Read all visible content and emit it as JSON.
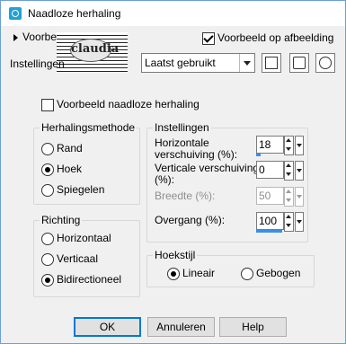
{
  "window": {
    "title": "Naadloze herhaling"
  },
  "preview": {
    "toggle_label": "Voorbeeld",
    "stamp_text": "claudia"
  },
  "header": {
    "preview_on_image_label": "Voorbeeld op afbeelding",
    "preview_on_image_checked": true,
    "settings_label": "Instellingen",
    "preset_value": "Laatst gebruikt"
  },
  "seamless_preview": {
    "label": "Voorbeeld naadloze herhaling",
    "checked": false
  },
  "repeat_method": {
    "title": "Herhalingsmethode",
    "options": [
      "Rand",
      "Hoek",
      "Spiegelen"
    ],
    "selected": "Hoek"
  },
  "direction": {
    "title": "Richting",
    "options": [
      "Horizontaal",
      "Verticaal",
      "Bidirectioneel"
    ],
    "selected": "Bidirectioneel"
  },
  "settings": {
    "title": "Instellingen",
    "horizontal_offset": {
      "label_line1": "Horizontale",
      "label_line2": "verschuiving (%):",
      "value": "18",
      "fill": 0.18
    },
    "vertical_offset": {
      "label_line1": "Verticale verschuiving",
      "label_line2": "(%):",
      "value": "0",
      "fill": 0.0
    },
    "width": {
      "label": "Breedte (%):",
      "value": "50",
      "enabled": false
    },
    "transition": {
      "label": "Overgang (%):",
      "value": "100",
      "fill": 1.0
    }
  },
  "corner_style": {
    "title": "Hoekstijl",
    "options": [
      "Lineair",
      "Gebogen"
    ],
    "selected": "Lineair"
  },
  "buttons": {
    "ok": "OK",
    "cancel": "Annuleren",
    "help": "Help"
  },
  "colors": {
    "accent": "#3c8fe4",
    "frame": "#6b9fd8",
    "app_icon": "#1fa2d6"
  }
}
